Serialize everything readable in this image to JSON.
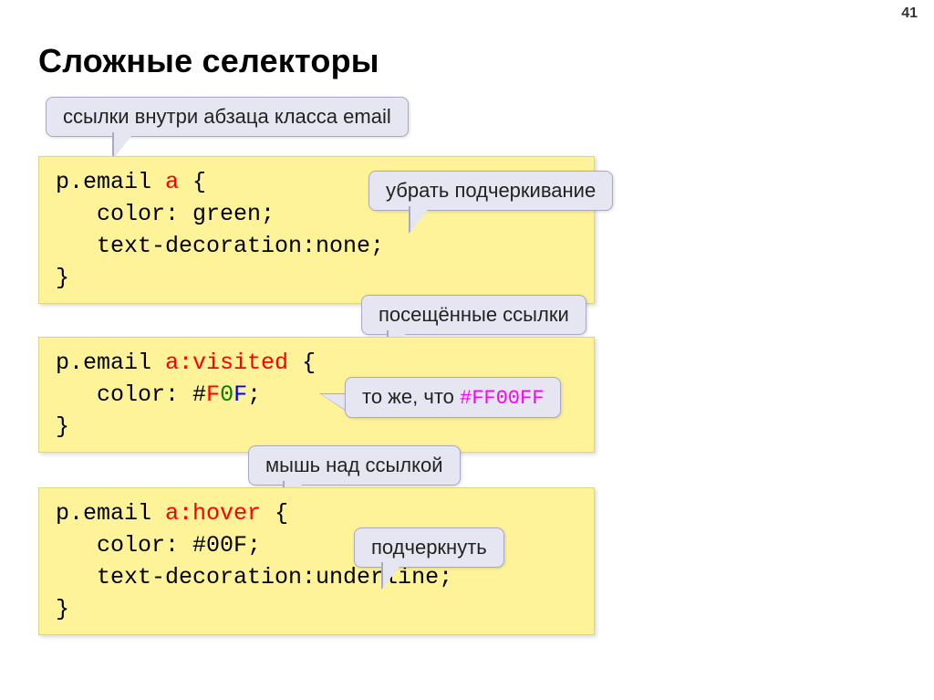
{
  "page_number": "41",
  "title": "Сложные селекторы",
  "callouts": {
    "c1": "ссылки внутри абзаца класса email",
    "c2": "убрать подчеркивание",
    "c3": "посещённые ссылки",
    "c4_prefix": "то же, что ",
    "c4_code": "#FF00FF",
    "c5": "мышь над ссылкой",
    "c6": "подчеркнуть"
  },
  "code1": {
    "l1a": "p.email ",
    "l1b": "a",
    "l1c": " {",
    "l2": "   color: green;",
    "l3": "   text-decoration:none;",
    "l4": "}"
  },
  "code2": {
    "l1a": "p.email ",
    "l1b": "a:visited",
    "l1c": " {",
    "l2a": "   color: ",
    "hash": "#",
    "f1": "F",
    "z": "0",
    "f2": "F",
    "semi": ";",
    "l3": "}"
  },
  "code3": {
    "l1a": "p.email ",
    "l1b": "a:hover",
    "l1c": " {",
    "l2": "   color: #00F;",
    "l3": "   text-decoration:underline;",
    "l4": "}"
  }
}
